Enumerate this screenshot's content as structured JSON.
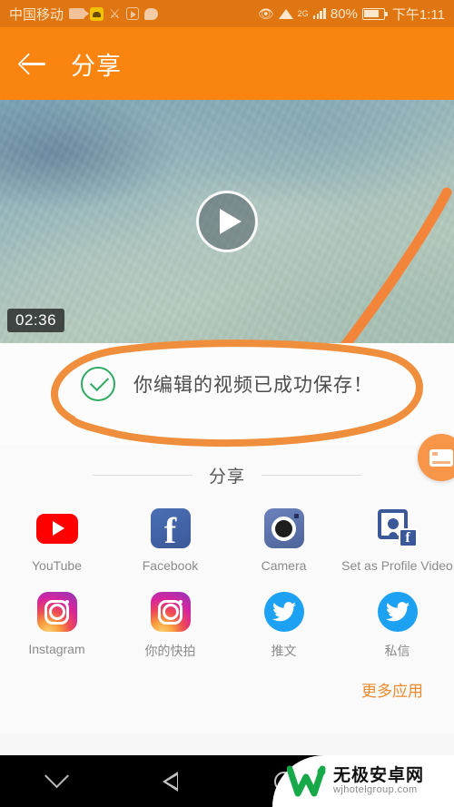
{
  "status_bar": {
    "carrier": "中国移动",
    "icons": [
      "video-camera-icon",
      "app-yellow-icon",
      "person-icon",
      "play-box-icon",
      "chat-bubble-icon"
    ],
    "eye_icon": "eye-icon",
    "wifi_icon": "wifi-icon",
    "network_type": "2G",
    "signal_icon": "signal-bars-icon",
    "battery_percent": "80%",
    "battery_icon": "battery-icon",
    "time": "下午1:11"
  },
  "app_bar": {
    "back_icon": "back-arrow-icon",
    "title": "分享"
  },
  "video": {
    "play_icon": "play-button-icon",
    "duration": "02:36",
    "annotation": "orange-hand-drawn-arrow"
  },
  "message": {
    "check_icon": "check-circle-icon",
    "text": "你编辑的视频已成功保存！",
    "annotation": "orange-hand-drawn-ellipse"
  },
  "float_button": {
    "icon": "card-icon"
  },
  "share": {
    "section_label": "分享",
    "items": [
      {
        "label": "YouTube",
        "icon": "youtube-icon"
      },
      {
        "label": "Facebook",
        "icon": "facebook-icon"
      },
      {
        "label": "Camera",
        "icon": "camera-icon"
      },
      {
        "label": "Set as Profile Video",
        "icon": "profile-video-icon"
      },
      {
        "label": "Instagram",
        "icon": "instagram-icon"
      },
      {
        "label": "你的快拍",
        "icon": "instagram-story-icon"
      },
      {
        "label": "推文",
        "icon": "twitter-icon"
      },
      {
        "label": "私信",
        "icon": "twitter-dm-icon"
      }
    ],
    "more_label": "更多应用"
  },
  "nav_bar": {
    "hide_icon": "chevron-down-icon",
    "back_icon": "triangle-back-icon",
    "home_icon": "circle-home-icon"
  },
  "watermark": {
    "logo_icon": "w-logo-icon",
    "title": "无极安卓网",
    "url": "wjhotelgroup.com"
  },
  "colors": {
    "accent_orange": "#fa8410",
    "status_orange": "#e07612",
    "success_green": "#2eab62",
    "panel_bg": "#fafafa"
  }
}
